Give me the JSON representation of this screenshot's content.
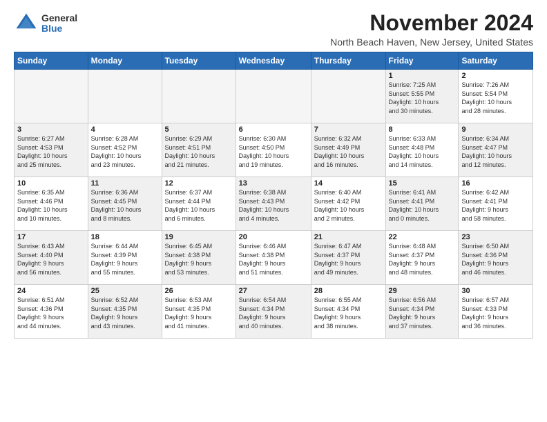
{
  "logo": {
    "general": "General",
    "blue": "Blue"
  },
  "title": "November 2024",
  "location": "North Beach Haven, New Jersey, United States",
  "headers": [
    "Sunday",
    "Monday",
    "Tuesday",
    "Wednesday",
    "Thursday",
    "Friday",
    "Saturday"
  ],
  "weeks": [
    [
      {
        "day": "",
        "info": "",
        "empty": true
      },
      {
        "day": "",
        "info": "",
        "empty": true
      },
      {
        "day": "",
        "info": "",
        "empty": true
      },
      {
        "day": "",
        "info": "",
        "empty": true
      },
      {
        "day": "",
        "info": "",
        "empty": true
      },
      {
        "day": "1",
        "info": "Sunrise: 7:25 AM\nSunset: 5:55 PM\nDaylight: 10 hours\nand 30 minutes.",
        "shaded": true
      },
      {
        "day": "2",
        "info": "Sunrise: 7:26 AM\nSunset: 5:54 PM\nDaylight: 10 hours\nand 28 minutes.",
        "shaded": false
      }
    ],
    [
      {
        "day": "3",
        "info": "Sunrise: 6:27 AM\nSunset: 4:53 PM\nDaylight: 10 hours\nand 25 minutes.",
        "shaded": true
      },
      {
        "day": "4",
        "info": "Sunrise: 6:28 AM\nSunset: 4:52 PM\nDaylight: 10 hours\nand 23 minutes.",
        "shaded": false
      },
      {
        "day": "5",
        "info": "Sunrise: 6:29 AM\nSunset: 4:51 PM\nDaylight: 10 hours\nand 21 minutes.",
        "shaded": true
      },
      {
        "day": "6",
        "info": "Sunrise: 6:30 AM\nSunset: 4:50 PM\nDaylight: 10 hours\nand 19 minutes.",
        "shaded": false
      },
      {
        "day": "7",
        "info": "Sunrise: 6:32 AM\nSunset: 4:49 PM\nDaylight: 10 hours\nand 16 minutes.",
        "shaded": true
      },
      {
        "day": "8",
        "info": "Sunrise: 6:33 AM\nSunset: 4:48 PM\nDaylight: 10 hours\nand 14 minutes.",
        "shaded": false
      },
      {
        "day": "9",
        "info": "Sunrise: 6:34 AM\nSunset: 4:47 PM\nDaylight: 10 hours\nand 12 minutes.",
        "shaded": true
      }
    ],
    [
      {
        "day": "10",
        "info": "Sunrise: 6:35 AM\nSunset: 4:46 PM\nDaylight: 10 hours\nand 10 minutes.",
        "shaded": false
      },
      {
        "day": "11",
        "info": "Sunrise: 6:36 AM\nSunset: 4:45 PM\nDaylight: 10 hours\nand 8 minutes.",
        "shaded": true
      },
      {
        "day": "12",
        "info": "Sunrise: 6:37 AM\nSunset: 4:44 PM\nDaylight: 10 hours\nand 6 minutes.",
        "shaded": false
      },
      {
        "day": "13",
        "info": "Sunrise: 6:38 AM\nSunset: 4:43 PM\nDaylight: 10 hours\nand 4 minutes.",
        "shaded": true
      },
      {
        "day": "14",
        "info": "Sunrise: 6:40 AM\nSunset: 4:42 PM\nDaylight: 10 hours\nand 2 minutes.",
        "shaded": false
      },
      {
        "day": "15",
        "info": "Sunrise: 6:41 AM\nSunset: 4:41 PM\nDaylight: 10 hours\nand 0 minutes.",
        "shaded": true
      },
      {
        "day": "16",
        "info": "Sunrise: 6:42 AM\nSunset: 4:41 PM\nDaylight: 9 hours\nand 58 minutes.",
        "shaded": false
      }
    ],
    [
      {
        "day": "17",
        "info": "Sunrise: 6:43 AM\nSunset: 4:40 PM\nDaylight: 9 hours\nand 56 minutes.",
        "shaded": true
      },
      {
        "day": "18",
        "info": "Sunrise: 6:44 AM\nSunset: 4:39 PM\nDaylight: 9 hours\nand 55 minutes.",
        "shaded": false
      },
      {
        "day": "19",
        "info": "Sunrise: 6:45 AM\nSunset: 4:38 PM\nDaylight: 9 hours\nand 53 minutes.",
        "shaded": true
      },
      {
        "day": "20",
        "info": "Sunrise: 6:46 AM\nSunset: 4:38 PM\nDaylight: 9 hours\nand 51 minutes.",
        "shaded": false
      },
      {
        "day": "21",
        "info": "Sunrise: 6:47 AM\nSunset: 4:37 PM\nDaylight: 9 hours\nand 49 minutes.",
        "shaded": true
      },
      {
        "day": "22",
        "info": "Sunrise: 6:48 AM\nSunset: 4:37 PM\nDaylight: 9 hours\nand 48 minutes.",
        "shaded": false
      },
      {
        "day": "23",
        "info": "Sunrise: 6:50 AM\nSunset: 4:36 PM\nDaylight: 9 hours\nand 46 minutes.",
        "shaded": true
      }
    ],
    [
      {
        "day": "24",
        "info": "Sunrise: 6:51 AM\nSunset: 4:36 PM\nDaylight: 9 hours\nand 44 minutes.",
        "shaded": false
      },
      {
        "day": "25",
        "info": "Sunrise: 6:52 AM\nSunset: 4:35 PM\nDaylight: 9 hours\nand 43 minutes.",
        "shaded": true
      },
      {
        "day": "26",
        "info": "Sunrise: 6:53 AM\nSunset: 4:35 PM\nDaylight: 9 hours\nand 41 minutes.",
        "shaded": false
      },
      {
        "day": "27",
        "info": "Sunrise: 6:54 AM\nSunset: 4:34 PM\nDaylight: 9 hours\nand 40 minutes.",
        "shaded": true
      },
      {
        "day": "28",
        "info": "Sunrise: 6:55 AM\nSunset: 4:34 PM\nDaylight: 9 hours\nand 38 minutes.",
        "shaded": false
      },
      {
        "day": "29",
        "info": "Sunrise: 6:56 AM\nSunset: 4:34 PM\nDaylight: 9 hours\nand 37 minutes.",
        "shaded": true
      },
      {
        "day": "30",
        "info": "Sunrise: 6:57 AM\nSunset: 4:33 PM\nDaylight: 9 hours\nand 36 minutes.",
        "shaded": false
      }
    ]
  ]
}
